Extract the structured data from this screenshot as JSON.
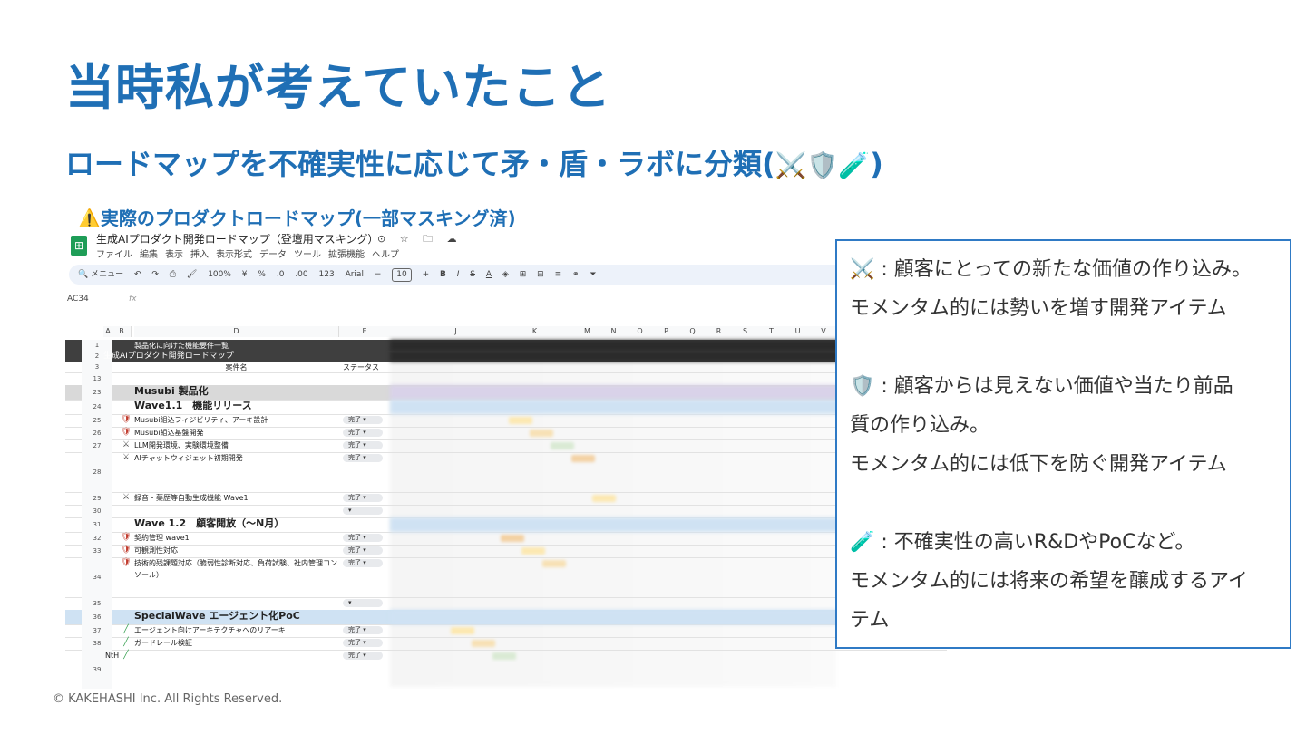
{
  "slide": {
    "title": "当時私が考えていたこと",
    "subtitle": "ロードマップを不確実性に応じて矛・盾・ラボに分類(",
    "subtitle_end": ")",
    "subtitle_icons": [
      "⚔️",
      "🛡️",
      "🧪"
    ],
    "caption": "⚠️実際のプロダクトロードマップ(一部マスキング済)",
    "footer": "© KAKEHASHI Inc. All Rights Reserved."
  },
  "spreadsheet": {
    "doc_title": "生成AIプロダクト開発ロードマップ（登壇用マスキング）",
    "doc_icons": "⊙ ☆ 🗀 ☁",
    "menu": [
      "ファイル",
      "編集",
      "表示",
      "挿入",
      "表示形式",
      "データ",
      "ツール",
      "拡張機能",
      "ヘルプ"
    ],
    "toolbar": {
      "search": "🔍 メニュー",
      "zoom": "100%",
      "currency": "¥",
      "percent": "%",
      "decimal_less": ".0",
      "decimal_more": ".00",
      "number_format": "123",
      "font": "Arial",
      "font_size": "10",
      "bold": "B",
      "italic": "I",
      "strike": "S",
      "text_color": "A"
    },
    "cell_ref": "AC34",
    "fx": "fx",
    "columns": [
      "A",
      "B",
      "D",
      "E",
      "J",
      "K",
      "L",
      "M",
      "N",
      "O",
      "P",
      "Q",
      "R",
      "S",
      "T",
      "U",
      "V"
    ],
    "header_rows": [
      {
        "num": "1",
        "text": "製品化に向けた機能要件一覧"
      },
      {
        "num": "2",
        "text": "生成AIプロダクト開発ロードマップ"
      },
      {
        "num": "3",
        "text": "案件名",
        "status": "ステータス"
      }
    ],
    "rows": [
      {
        "num": "13",
        "type": "blank",
        "icon": "",
        "text": "",
        "status": ""
      },
      {
        "num": "23",
        "type": "section",
        "icon": "",
        "text": "Musubi 製品化",
        "status": ""
      },
      {
        "num": "24",
        "type": "wave",
        "icon": "",
        "text": "Wave1.1　機能リリース",
        "status": ""
      },
      {
        "num": "25",
        "type": "item",
        "icon": "shield",
        "text": "Musubi組込フィジビリティ、アーキ設計",
        "status": "完了"
      },
      {
        "num": "26",
        "type": "item",
        "icon": "shield",
        "text": "Musubi組込基盤開発",
        "status": "完了"
      },
      {
        "num": "27",
        "type": "item",
        "icon": "swords",
        "text": "LLM開発環境、実験環境整備",
        "status": "完了"
      },
      {
        "num": "28",
        "type": "item-tall",
        "icon": "swords",
        "text": "AIチャットウィジェット初期開発",
        "status": "完了"
      },
      {
        "num": "29",
        "type": "item",
        "icon": "swords",
        "text": "録音・薬歴等自動生成機能 Wave1",
        "status": "完了"
      },
      {
        "num": "30",
        "type": "blank",
        "icon": "",
        "text": "",
        "status": ""
      },
      {
        "num": "31",
        "type": "wave",
        "icon": "",
        "text": "Wave 1.2　顧客開放（〜N月）",
        "status": ""
      },
      {
        "num": "32",
        "type": "item",
        "icon": "shield",
        "text": "契約管理 wave1",
        "status": "完了"
      },
      {
        "num": "33",
        "type": "item",
        "icon": "shield",
        "text": "可観測性対応",
        "status": "完了"
      },
      {
        "num": "34",
        "type": "item-tall",
        "icon": "shield",
        "text": "技術的残課題対応（脆弱性診断対応、負荷試験、社内管理コンソール）",
        "status": "完了"
      },
      {
        "num": "35",
        "type": "blank",
        "icon": "",
        "text": "",
        "status": ""
      },
      {
        "num": "36",
        "type": "special",
        "icon": "",
        "text": "SpecialWave エージェント化PoC",
        "status": ""
      },
      {
        "num": "37",
        "type": "item",
        "icon": "tube",
        "text": "エージェント向けアーキテクチャへのリアーキ",
        "status": "完了"
      },
      {
        "num": "38",
        "type": "item",
        "icon": "tube",
        "text": "ガードレール検証",
        "status": "完了"
      },
      {
        "num": "39",
        "type": "item-tall",
        "icon": "tube",
        "prefix": "NtH",
        "text": "",
        "status": "完了"
      }
    ]
  },
  "legend": {
    "line1": "⚔️ : 顧客にとっての新たな価値の作り込み。",
    "line2": "モメンタム的には勢いを増す開発アイテム",
    "line3": "🛡️ : 顧客からは見えない価値や当たり前品",
    "line4": "質の作り込み。",
    "line5": "モメンタム的には低下を防ぐ開発アイテム",
    "line6": "🧪 : 不確実性の高いR&DやPoCなど。",
    "line7": "モメンタム的には将来の希望を醸成するアイ",
    "line8": "テム"
  },
  "colors": {
    "accent": "#1f6fb5",
    "legend_border": "#2f7ac5",
    "sheets_green": "#1e9d57",
    "section_gray": "#d9d9d9",
    "special_blue": "#cfe2f3"
  },
  "icons": {
    "swords": "⚔",
    "shield": "🛡",
    "tube": "🧪"
  }
}
